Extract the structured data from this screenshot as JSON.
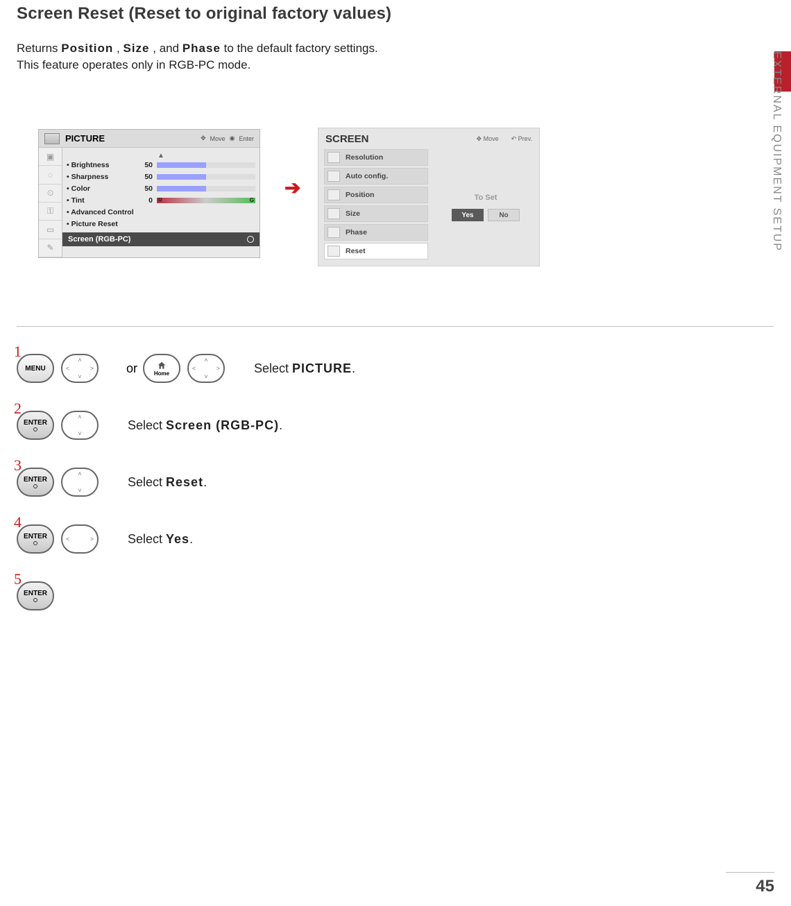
{
  "page": {
    "title": "Screen Reset (Reset to original factory values)",
    "sub_prefix": "Returns ",
    "sub_w1": "Position",
    "sub_sep1": ", ",
    "sub_w2": "Size",
    "sub_sep2": ", and ",
    "sub_w3": "Phase",
    "sub_suffix": " to the default factory settings.",
    "sub2": "This feature operates only in RGB-PC mode.",
    "side_label": "EXTERNAL EQUIPMENT SETUP",
    "page_number": "45"
  },
  "picture_panel": {
    "title": "PICTURE",
    "hint_move": "Move",
    "hint_enter": "Enter",
    "items": [
      {
        "label": "• Brightness",
        "value": "50",
        "fill": 50,
        "type": "bar"
      },
      {
        "label": "• Sharpness",
        "value": "50",
        "fill": 50,
        "type": "bar"
      },
      {
        "label": "• Color",
        "value": "50",
        "fill": 50,
        "type": "bar"
      },
      {
        "label": "• Tint",
        "value": "0",
        "type": "tint",
        "r": "R",
        "g": "G"
      },
      {
        "label": "• Advanced Control",
        "type": "noval"
      },
      {
        "label": "• Picture Reset",
        "type": "noval"
      }
    ],
    "selected": "Screen (RGB-PC)"
  },
  "screen_panel": {
    "title": "SCREEN",
    "hint_move": "Move",
    "hint_prev": "Prev.",
    "items": [
      {
        "label": "Resolution"
      },
      {
        "label": "Auto config."
      },
      {
        "label": "Position"
      },
      {
        "label": "Size"
      },
      {
        "label": "Phase"
      },
      {
        "label": "Reset",
        "active": true
      }
    ],
    "to_set": "To Set",
    "yes": "Yes",
    "no": "No"
  },
  "steps": {
    "s1": {
      "num": "1",
      "menu": "MENU",
      "home": "Home",
      "or": "or",
      "txt_pre": "Select ",
      "txt_b": "PICTURE",
      "txt_post": "."
    },
    "s2": {
      "num": "2",
      "enter": "ENTER",
      "txt_pre": "Select ",
      "txt_b": "Screen (RGB-PC)",
      "txt_post": "."
    },
    "s3": {
      "num": "3",
      "enter": "ENTER",
      "txt_pre": "Select ",
      "txt_b": "Reset",
      "txt_post": "."
    },
    "s4": {
      "num": "4",
      "enter": "ENTER",
      "txt_pre": "Select ",
      "txt_b": "Yes",
      "txt_post": "."
    },
    "s5": {
      "num": "5",
      "enter": "ENTER"
    }
  }
}
